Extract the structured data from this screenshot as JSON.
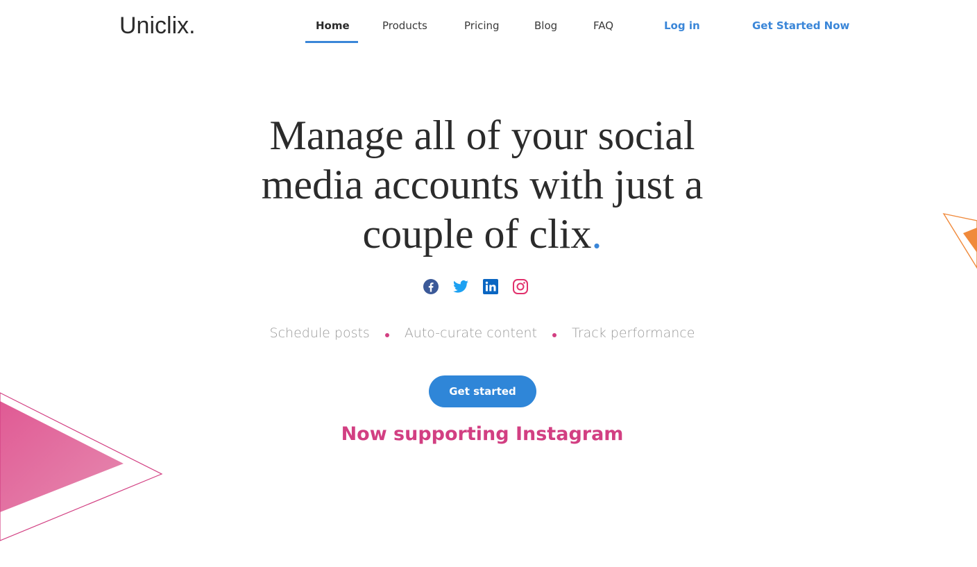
{
  "header": {
    "logo": "Uniclix.",
    "nav": [
      {
        "label": "Home",
        "active": true
      },
      {
        "label": "Products"
      },
      {
        "label": "Pricing"
      },
      {
        "label": "Blog"
      },
      {
        "label": "FAQ"
      }
    ],
    "login_label": "Log in",
    "get_started_now_label": "Get Started Now"
  },
  "hero": {
    "title_line1": "Manage all of your social",
    "title_line2": "media accounts with just a",
    "title_line3": "couple of clix",
    "title_dot": ".",
    "socials": [
      {
        "icon": "facebook-icon",
        "color": "#3b5998"
      },
      {
        "icon": "twitter-icon",
        "color": "#1da1f2"
      },
      {
        "icon": "linkedin-icon",
        "color": "#0a66c2"
      },
      {
        "icon": "instagram-icon",
        "color": "#e1306c"
      }
    ],
    "features": [
      "Schedule posts",
      "Auto-curate content",
      "Track performance"
    ],
    "cta_label": "Get started",
    "support_text": "Now supporting Instagram"
  },
  "colors": {
    "accent": "#3a86d8",
    "pink": "#d23f82",
    "orange": "#f08a3c",
    "text": "#2b2b2b",
    "muted": "#9a9a9a"
  }
}
